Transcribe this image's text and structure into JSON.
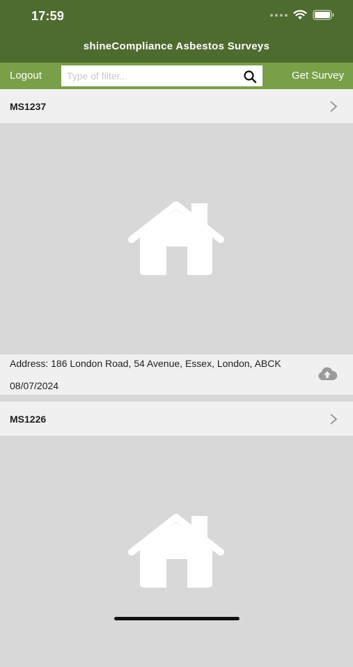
{
  "status_bar": {
    "time": "17:59"
  },
  "app": {
    "title": "shineCompliance Asbestos Surveys"
  },
  "toolbar": {
    "logout_label": "Logout",
    "get_survey_label": "Get Survey",
    "filter_placeholder": "Type of filter...",
    "filter_value": ""
  },
  "surveys": [
    {
      "id": "MS1237",
      "address": "Address: 186 London Road, 54 Avenue, Essex, London, ABCK",
      "date": "08/07/2024"
    },
    {
      "id": "MS1226"
    }
  ],
  "colors": {
    "header_dark_green": "#4e6b30",
    "toolbar_green": "#79a048",
    "row_background": "#f0f0f0",
    "image_background": "#d8d8d8"
  },
  "icons": {
    "status": [
      "cellular-signal-icon",
      "wifi-icon",
      "battery-icon"
    ],
    "toolbar": [
      "search-icon"
    ],
    "survey": [
      "chevron-right-icon",
      "house-icon",
      "cloud-upload-icon"
    ]
  }
}
